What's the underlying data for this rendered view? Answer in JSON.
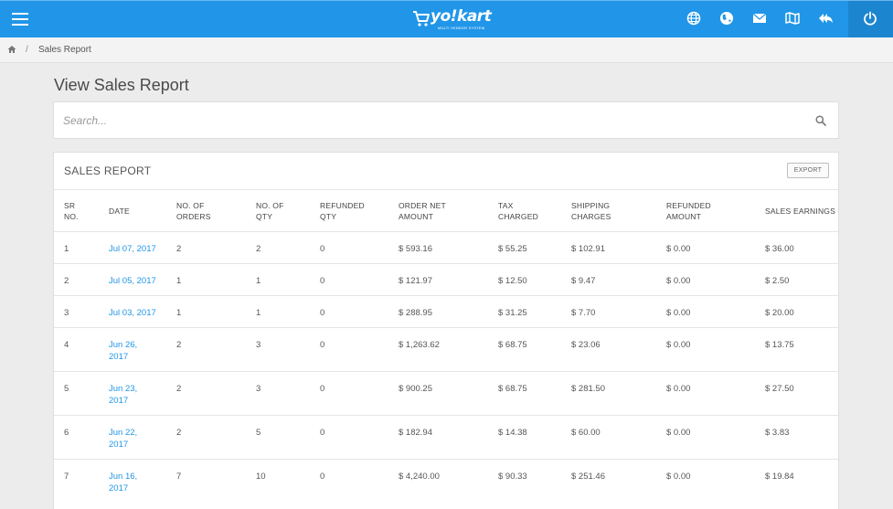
{
  "app": {
    "brand": "yo!kart",
    "tagline": "MULTI VENDOR SYSTEM"
  },
  "topbar": {
    "icons": [
      "menu-icon",
      "language-icon",
      "globe-icon",
      "mail-icon",
      "map-icon",
      "reply-icon",
      "power-icon"
    ],
    "colors": {
      "bar": "#2196e8",
      "power": "#1c85d0"
    }
  },
  "breadcrumb": {
    "current": "Sales Report",
    "separator": "/"
  },
  "page": {
    "title": "View Sales Report"
  },
  "search": {
    "placeholder": "Search..."
  },
  "report": {
    "title": "SALES REPORT",
    "export_label": "EXPORT",
    "columns": [
      {
        "line1": "SR",
        "line2": "NO."
      },
      {
        "line1": "DATE",
        "line2": ""
      },
      {
        "line1": "NO. OF",
        "line2": "ORDERS"
      },
      {
        "line1": "NO. OF",
        "line2": "QTY"
      },
      {
        "line1": "REFUNDED",
        "line2": "QTY"
      },
      {
        "line1": "ORDER NET",
        "line2": "AMOUNT"
      },
      {
        "line1": "TAX",
        "line2": "CHARGED"
      },
      {
        "line1": "SHIPPING",
        "line2": "CHARGES"
      },
      {
        "line1": "REFUNDED",
        "line2": "AMOUNT"
      },
      {
        "line1": "SALES EARNINGS",
        "line2": ""
      }
    ],
    "rows": [
      {
        "sr": "1",
        "date1": "Jul 07, 2017",
        "date2": "",
        "orders": "2",
        "qty": "2",
        "refunded_qty": "0",
        "net": "$ 593.16",
        "tax": "$ 55.25",
        "shipping": "$ 102.91",
        "refunded_amt": "$ 0.00",
        "earnings": "$ 36.00"
      },
      {
        "sr": "2",
        "date1": "Jul 05, 2017",
        "date2": "",
        "orders": "1",
        "qty": "1",
        "refunded_qty": "0",
        "net": "$ 121.97",
        "tax": "$ 12.50",
        "shipping": "$ 9.47",
        "refunded_amt": "$ 0.00",
        "earnings": "$ 2.50"
      },
      {
        "sr": "3",
        "date1": "Jul 03, 2017",
        "date2": "",
        "orders": "1",
        "qty": "1",
        "refunded_qty": "0",
        "net": "$ 288.95",
        "tax": "$ 31.25",
        "shipping": "$ 7.70",
        "refunded_amt": "$ 0.00",
        "earnings": "$ 20.00"
      },
      {
        "sr": "4",
        "date1": "Jun 26,",
        "date2": "2017",
        "orders": "2",
        "qty": "3",
        "refunded_qty": "0",
        "net": "$ 1,263.62",
        "tax": "$ 68.75",
        "shipping": "$ 23.06",
        "refunded_amt": "$ 0.00",
        "earnings": "$ 13.75"
      },
      {
        "sr": "5",
        "date1": "Jun 23,",
        "date2": "2017",
        "orders": "2",
        "qty": "3",
        "refunded_qty": "0",
        "net": "$ 900.25",
        "tax": "$ 68.75",
        "shipping": "$ 281.50",
        "refunded_amt": "$ 0.00",
        "earnings": "$ 27.50"
      },
      {
        "sr": "6",
        "date1": "Jun 22,",
        "date2": "2017",
        "orders": "2",
        "qty": "5",
        "refunded_qty": "0",
        "net": "$ 182.94",
        "tax": "$ 14.38",
        "shipping": "$ 60.00",
        "refunded_amt": "$ 0.00",
        "earnings": "$ 3.83"
      },
      {
        "sr": "7",
        "date1": "Jun 16,",
        "date2": "2017",
        "orders": "7",
        "qty": "10",
        "refunded_qty": "0",
        "net": "$ 4,240.00",
        "tax": "$ 90.33",
        "shipping": "$ 251.46",
        "refunded_amt": "$ 0.00",
        "earnings": "$ 19.84"
      }
    ]
  }
}
